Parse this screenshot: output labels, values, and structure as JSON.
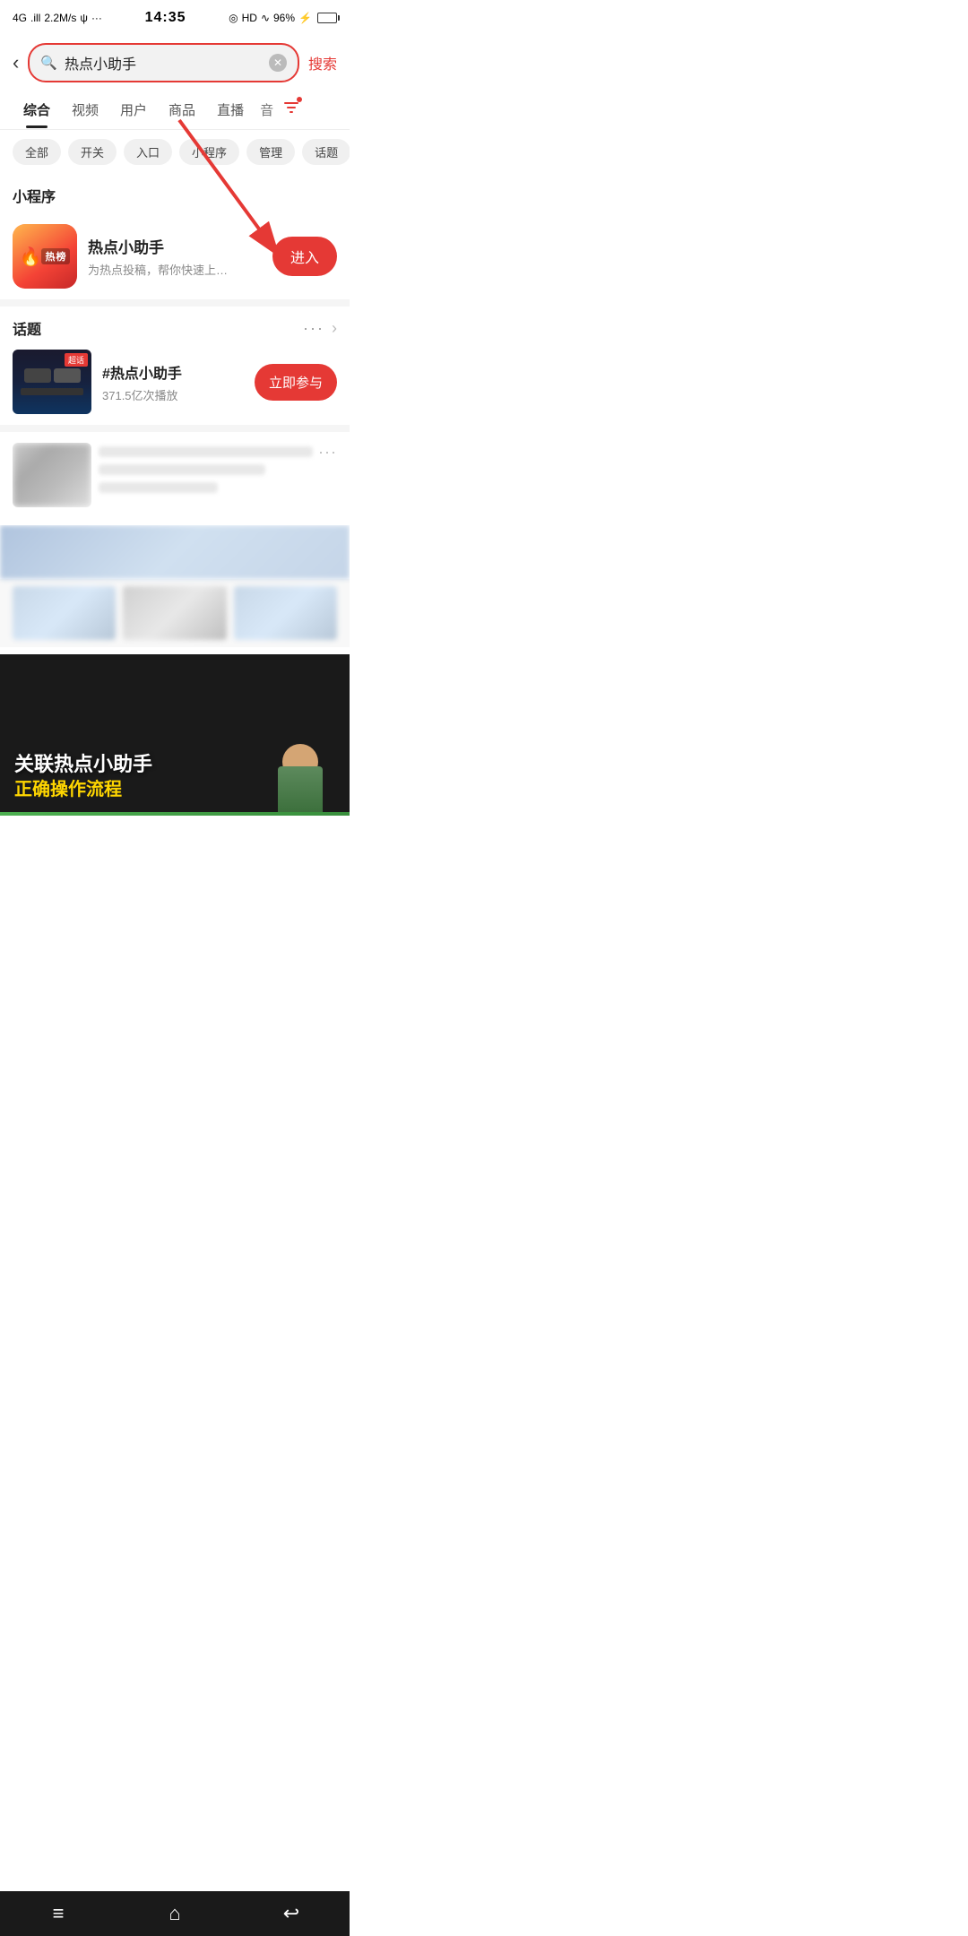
{
  "statusBar": {
    "left": "4G  .ill  2.2M/s  ψ  ···",
    "center": "14:35",
    "right": "HD  ◉  96%  ⚡"
  },
  "searchBar": {
    "backLabel": "‹",
    "query": "热点小助手",
    "clearLabel": "×",
    "searchLabel": "搜索"
  },
  "tabs": [
    {
      "label": "综合",
      "active": true
    },
    {
      "label": "视频",
      "active": false
    },
    {
      "label": "用户",
      "active": false
    },
    {
      "label": "商品",
      "active": false
    },
    {
      "label": "直播",
      "active": false
    },
    {
      "label": "音",
      "active": false
    }
  ],
  "filterTags": [
    {
      "label": "全部"
    },
    {
      "label": "开关"
    },
    {
      "label": "入口"
    },
    {
      "label": "小程序"
    },
    {
      "label": "管理"
    },
    {
      "label": "话题"
    }
  ],
  "miniProgram": {
    "sectionTitle": "小程序",
    "appName": "热点小助手",
    "appDesc": "为热点投稿，帮你快速上…",
    "enterLabel": "进入",
    "iconFireEmoji": "🔥",
    "iconLabel": "热榜"
  },
  "topic": {
    "sectionTitle": "话题",
    "moreLabel": "···",
    "chevron": "›",
    "hashtag": "#热点小助手",
    "stats": "371.5亿次播放",
    "participateLabel": "立即参与",
    "redBadge": "超话"
  },
  "videoCard": {
    "title": "关联热点小助手",
    "subtitle": "正确操作流程"
  },
  "bottomNav": {
    "menuIcon": "≡",
    "homeIcon": "⌂",
    "backIcon": "↩"
  }
}
